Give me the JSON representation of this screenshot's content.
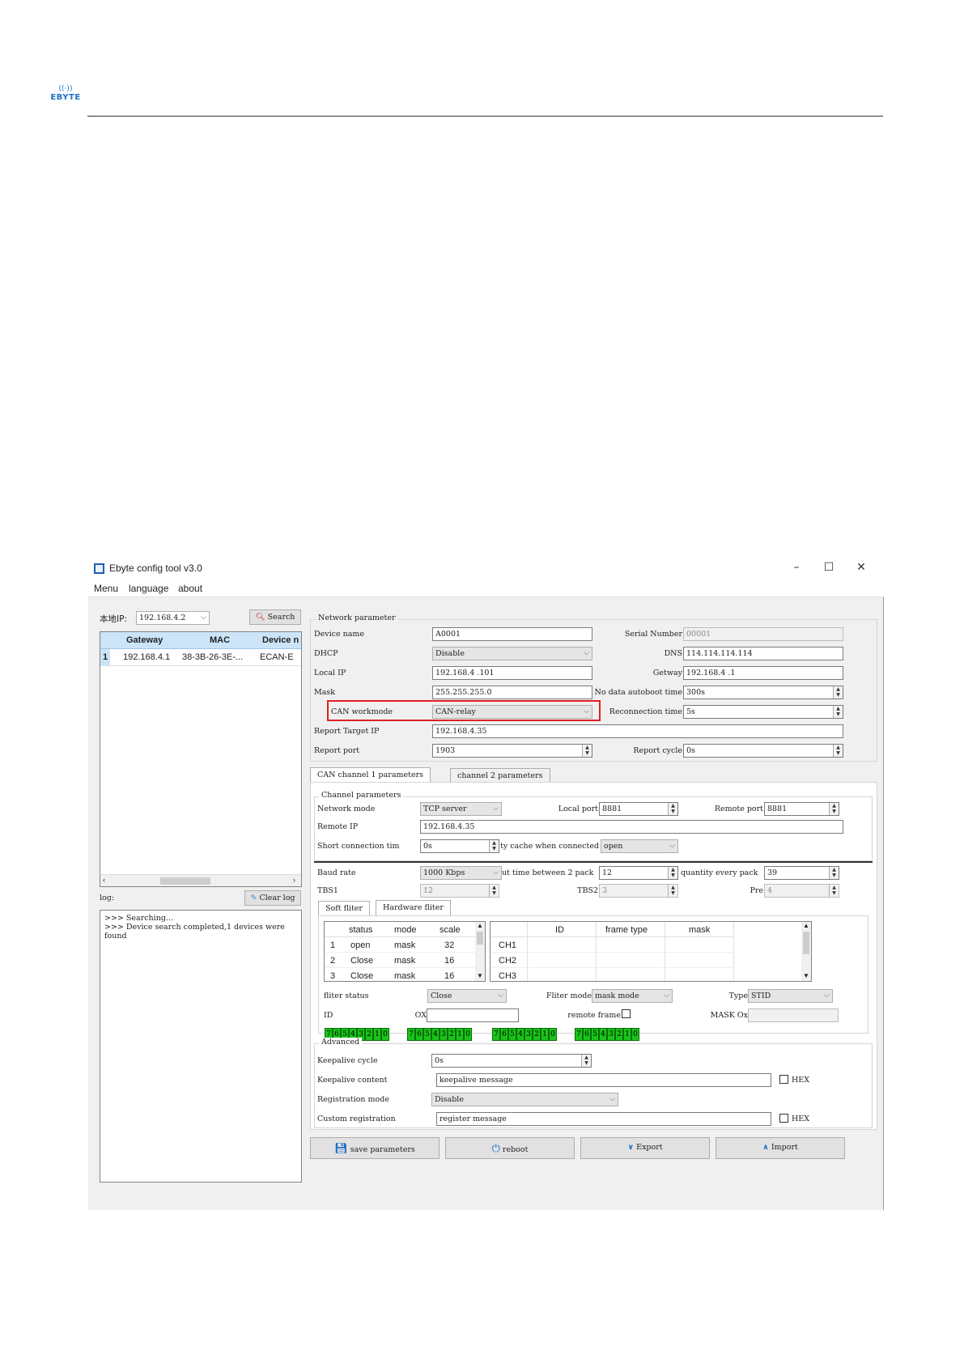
{
  "window": {
    "title": "Ebyte config tool v3.0",
    "menu": [
      "Menu",
      "language",
      "about"
    ],
    "controls": {
      "minimize": "–",
      "maximize": "☐",
      "close": "✕"
    }
  },
  "left": {
    "local_ip_label": "本地IP:",
    "local_ip_value": "192.168.4.2",
    "search_label": "Search",
    "table": {
      "headers": [
        "Gateway",
        "MAC",
        "Device n"
      ],
      "rows": [
        {
          "index": "1",
          "gateway": "192.168.4.1",
          "mac": "38-3B-26-3E-...",
          "device": "ECAN-E"
        }
      ]
    },
    "log_label": "log:",
    "clear_log_label": "Clear log",
    "log_lines": [
      ">>> Searching...",
      ">>> Device search completed,1 devices were found"
    ]
  },
  "network": {
    "title": "Network parameter",
    "device_name_label": "Device name",
    "device_name": "A0001",
    "serial_label": "Serial Number",
    "serial": "00001",
    "dhcp_label": "DHCP",
    "dhcp": "Disable",
    "dns_label": "DNS",
    "dns": "114.114.114.114",
    "local_ip_label": "Local IP",
    "local_ip": "192.168.4  .101",
    "getway_label": "Getway",
    "getway": "192.168.4  .1",
    "mask_label": "Mask",
    "mask": "255.255.255.0",
    "nodata_label": "No data autoboot time",
    "nodata": "300s",
    "workmode_label": "CAN workmode",
    "workmode": "CAN-relay",
    "reconnect_label": "Reconnection time",
    "reconnect": "5s",
    "report_ip_label": "Report Target IP",
    "report_ip": "192.168.4.35",
    "report_port_label": "Report port",
    "report_port": "1903",
    "report_cycle_label": "Report cycle",
    "report_cycle": "0s"
  },
  "tabs": [
    "CAN channel 1 parameters",
    "channel 2 parameters"
  ],
  "channel": {
    "title": "Channel parameters",
    "netmode_label": "Network mode",
    "netmode": "TCP server",
    "local_port_label": "Local port",
    "local_port": "8881",
    "remote_port_label": "Remote port",
    "remote_port": "8881",
    "remote_ip_label": "Remote IP",
    "remote_ip": "192.168.4.35",
    "short_label": "Short connection tim",
    "short": "0s",
    "cache_label": "ty cache when connected",
    "cache": "open",
    "baud_label": "Baud rate",
    "baud": "1000 Kbps",
    "between_label": "ut time between 2 pack",
    "between": "12",
    "qty_label": "quantity every pack",
    "qty": "39",
    "tbs1_label": "TBS1",
    "tbs1": "12",
    "tbs2_label": "TBS2",
    "tbs2": "3",
    "pre_label": "Pre",
    "pre": "4"
  },
  "filter_tabs": [
    "Soft fliter",
    "Hardware fliter"
  ],
  "filter_table": {
    "headers": [
      "status",
      "mode",
      "scale"
    ],
    "rows": [
      {
        "i": "1",
        "status": "open",
        "mode": "mask",
        "scale": "32"
      },
      {
        "i": "2",
        "status": "Close",
        "mode": "mask",
        "scale": "16"
      },
      {
        "i": "3",
        "status": "Close",
        "mode": "mask",
        "scale": "16"
      }
    ]
  },
  "ch_table": {
    "headers": [
      "ID",
      "frame type",
      "mask"
    ],
    "rows": [
      "CH1",
      "CH2",
      "CH3"
    ]
  },
  "filter": {
    "status_label": "fliter status",
    "status": "Close",
    "mode_label": "Fliter mode",
    "mode": "mask mode",
    "type_label": "Type",
    "type": "STID",
    "id_label": "ID",
    "ox_label": "OX",
    "remote_label": "remote frame",
    "maskox_label": "MASK Ox"
  },
  "bit_groups": [
    [
      "7",
      "6",
      "5",
      "4",
      "3",
      "2",
      "1",
      "0"
    ],
    [
      "7",
      "6",
      "5",
      "4",
      "3",
      "2",
      "1",
      "0"
    ],
    [
      "7",
      "6",
      "5",
      "4",
      "3",
      "2",
      "1",
      "0"
    ],
    [
      "7",
      "6",
      "5",
      "4",
      "3",
      "2",
      "1",
      "0"
    ]
  ],
  "advanced": {
    "title": "Advanced",
    "keepalive_cycle_label": "Keepalive cycle",
    "keepalive_cycle": "0s",
    "keepalive_content_label": "Keepalive content",
    "keepalive_content": "keepalive message",
    "reg_mode_label": "Registration mode",
    "reg_mode": "Disable",
    "custom_reg_label": "Custom registration",
    "custom_reg": "register message",
    "hex_label": "HEX"
  },
  "buttons": {
    "save": "save parameters",
    "reboot": "reboot",
    "export": "Export",
    "import": "Import"
  },
  "colors": {
    "highlight_box": "#e02020",
    "bit_green": "#19c419",
    "header_blue": "#cce4f7"
  }
}
